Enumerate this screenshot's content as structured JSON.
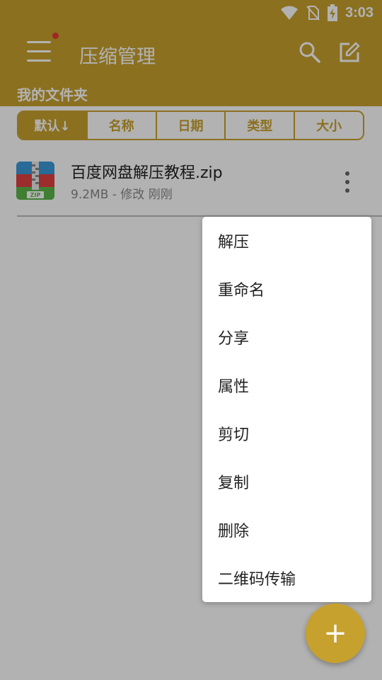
{
  "status_bar": {
    "time": "3:03",
    "icons": [
      "wifi-icon",
      "no-sim-icon",
      "battery-charging-icon"
    ]
  },
  "app_bar": {
    "title": "压缩管理",
    "icons": [
      "menu-icon",
      "search-icon",
      "edit-icon"
    ],
    "notification_dot_color": "#e53935"
  },
  "folder": {
    "title": "我的文件夹"
  },
  "sort_tabs": [
    {
      "label": "默认↓",
      "active": true
    },
    {
      "label": "名称",
      "active": false
    },
    {
      "label": "日期",
      "active": false
    },
    {
      "label": "类型",
      "active": false
    },
    {
      "label": "大小",
      "active": false
    }
  ],
  "files": [
    {
      "name": "百度网盘解压教程.zip",
      "meta": "9.2MB - 修改 刚刚",
      "icon": "zip-archive-icon",
      "icon_text": "ZIP"
    }
  ],
  "context_menu": {
    "items": [
      "解压",
      "重命名",
      "分享",
      "属性",
      "剪切",
      "复制",
      "删除",
      "二维码传输"
    ]
  },
  "fab": {
    "label": "+"
  },
  "colors": {
    "primary": "#c7a12e",
    "scrim": "rgba(0,0,0,0.30)"
  }
}
